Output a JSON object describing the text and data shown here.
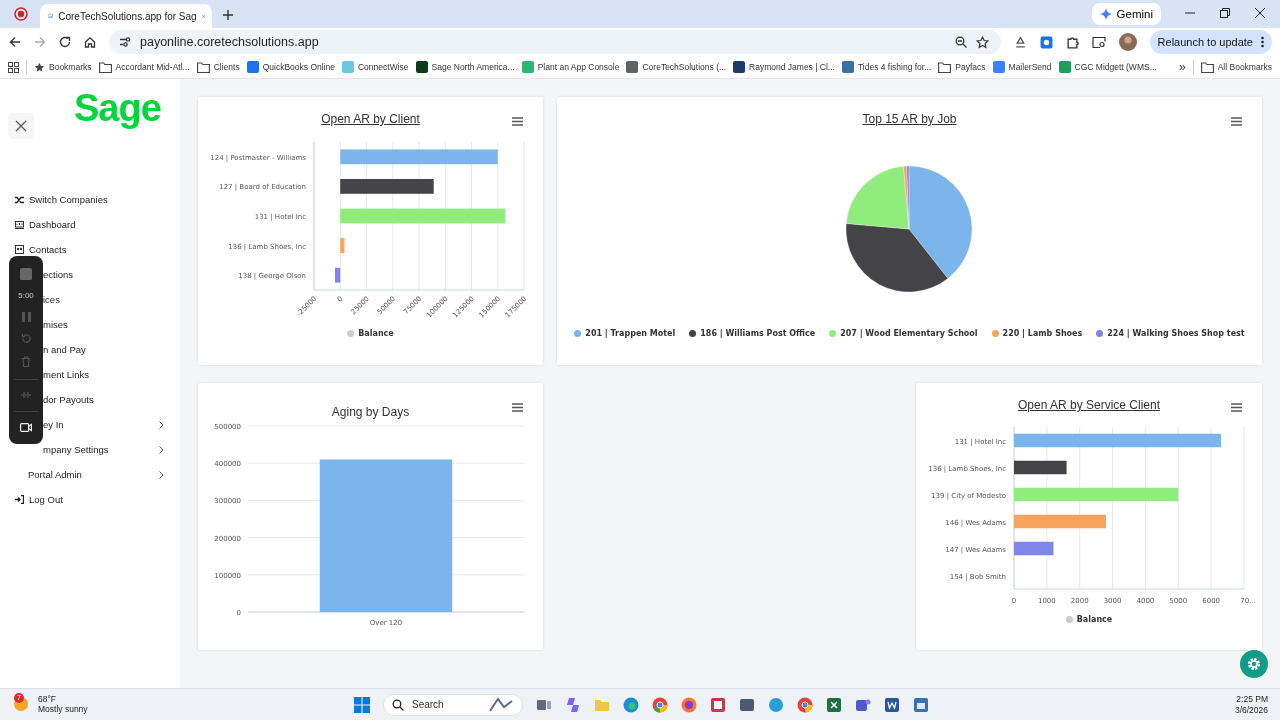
{
  "browser": {
    "tabs": [
      {
        "title": "CoreTechSolutions.app for Sag",
        "selected": true
      }
    ],
    "gemini_button": "Gemini",
    "address": "payonline.coretechsolutions.app",
    "relaunch_button": "Relaunch to update",
    "bookmarks": [
      {
        "label": "Bookmarks",
        "kind": "star"
      },
      {
        "label": "Accordant Mid-Atl...",
        "kind": "folder"
      },
      {
        "label": "Clients",
        "kind": "folder"
      },
      {
        "label": "QuickBooks Online",
        "kind": "site",
        "color": "#1a73e8"
      },
      {
        "label": "ConnectWise",
        "kind": "site",
        "color": "#6cc6e0"
      },
      {
        "label": "Sage North America...",
        "kind": "site",
        "color": "#0b3d1c"
      },
      {
        "label": "Plant an App Console",
        "kind": "site",
        "color": "#2bb673"
      },
      {
        "label": "CoreTechSolutions (...",
        "kind": "site",
        "color": "#5f6368"
      },
      {
        "label": "Raymond James | Cl...",
        "kind": "site",
        "color": "#1f3a68"
      },
      {
        "label": "Tides 4 fishing for...",
        "kind": "site",
        "color": "#3b6ea5"
      },
      {
        "label": "Payfacs",
        "kind": "folder"
      },
      {
        "label": "MailerSend",
        "kind": "site",
        "color": "#3b82f6"
      },
      {
        "label": "CGC Midgett (WMS...",
        "kind": "site",
        "color": "#1e9e5a"
      }
    ],
    "more_bookmarks": "»",
    "all_bookmarks": "All Bookmarks"
  },
  "sidebar": {
    "logo": "Sage",
    "items": [
      {
        "label": "Switch Companies",
        "kind": "shuffle",
        "covered": false,
        "submenu": false
      },
      {
        "label": "Dashboard",
        "kind": "dashboard",
        "covered": false,
        "submenu": false
      },
      {
        "label": "Contacts",
        "kind": "contacts",
        "covered": false,
        "submenu": false
      },
      {
        "label": "ections",
        "kind": "plain",
        "covered": true,
        "submenu": false
      },
      {
        "label": "ices",
        "kind": "plain",
        "covered": true,
        "submenu": false
      },
      {
        "label": "mises",
        "kind": "plain",
        "covered": true,
        "submenu": false
      },
      {
        "label": "n and Pay",
        "kind": "plain",
        "covered": true,
        "submenu": false
      },
      {
        "label": "ment Links",
        "kind": "plain",
        "covered": true,
        "submenu": false
      },
      {
        "label": "dor Payouts",
        "kind": "plain",
        "covered": true,
        "submenu": false
      },
      {
        "label": "ey In",
        "kind": "plain",
        "covered": true,
        "submenu": true
      },
      {
        "label": "mpany Settings",
        "kind": "plain",
        "covered": true,
        "submenu": true
      },
      {
        "label": "Portal Admin",
        "kind": "plain",
        "covered": false,
        "submenu": true
      },
      {
        "label": "Log Out",
        "kind": "logout",
        "covered": false,
        "submenu": false
      }
    ]
  },
  "recorder": {
    "timer": "5:00"
  },
  "charts": [
    {
      "title": "Open AR by Client",
      "link": true,
      "chart_data": {
        "type": "bar",
        "orientation": "horizontal",
        "stacked": true,
        "grid": true,
        "categories": [
          "124 | Postmaster - Williams",
          "127 | Board of Education",
          "131 | Hotel Inc",
          "136 | Lamb Shoes, Inc",
          "138 | George Olson"
        ],
        "series": [
          {
            "name": "Balance",
            "color": "#7cb5ec",
            "values": [
              150000,
              null,
              null,
              null,
              null
            ]
          },
          {
            "color": "#434348",
            "values": [
              null,
              89000,
              null,
              null,
              null
            ]
          },
          {
            "color": "#90ed7d",
            "values": [
              null,
              null,
              157000,
              null,
              null
            ]
          },
          {
            "color": "#f7a35c",
            "values": [
              null,
              null,
              null,
              4000,
              null
            ]
          },
          {
            "color": "#8085e9",
            "values": [
              null,
              null,
              null,
              null,
              -5000
            ]
          }
        ],
        "xlim": [
          -25000,
          175000
        ],
        "xticks": [
          -25000,
          0,
          25000,
          50000,
          75000,
          100000,
          125000,
          150000,
          175000
        ]
      }
    },
    {
      "title": "Top 15 AR by Job",
      "link": true,
      "slices": [
        {
          "color": "#7cb5ec"
        },
        {
          "color": "#434348"
        },
        {
          "color": "#90ed7d"
        },
        {
          "color": "#f7a35c"
        },
        {
          "color": "#8085e9"
        }
      ],
      "chart_data": {
        "type": "pie",
        "categories": [
          "201 | Trappen Motel",
          "186 | Williams Post Office",
          "207 | Wood Elementary School",
          "220 | Lamb Shoes",
          "224 | Walking Shoes Shop test"
        ],
        "series": [
          {
            "values": [
              39.4,
              37.0,
              22.2,
              0.8,
              0.6
            ]
          }
        ]
      }
    },
    {
      "title": "Aging by Days",
      "link": false,
      "chart_data": {
        "type": "bar",
        "orientation": "vertical",
        "grid": true,
        "categories": [
          "Over 120"
        ],
        "series": [
          {
            "color": "#7cb5ec",
            "values": [
              410000
            ]
          }
        ],
        "ylim": [
          0,
          500000
        ],
        "yticks": [
          0,
          100000,
          200000,
          300000,
          400000,
          500000
        ]
      }
    },
    {
      "title": "Open AR by Service Client",
      "link": true,
      "chart_data": {
        "type": "bar",
        "orientation": "horizontal",
        "stacked": true,
        "grid": true,
        "categories": [
          "131 | Hotel Inc",
          "136 | Lamb Shoes, Inc",
          "139 | City of Modesto",
          "146 | Wes Adams",
          "147 | Wes Adams",
          "154 | Bob Smith"
        ],
        "series": [
          {
            "name": "Balance",
            "color": "#7cb5ec",
            "values": [
              6300,
              null,
              null,
              null,
              null,
              null
            ]
          },
          {
            "color": "#434348",
            "values": [
              null,
              1600,
              null,
              null,
              null,
              null
            ]
          },
          {
            "color": "#90ed7d",
            "values": [
              null,
              null,
              5000,
              null,
              null,
              null
            ]
          },
          {
            "color": "#f7a35c",
            "values": [
              null,
              null,
              null,
              2800,
              null,
              null
            ]
          },
          {
            "color": "#8085e9",
            "values": [
              null,
              null,
              null,
              null,
              1200,
              null
            ]
          },
          {
            "color": "#f15c80",
            "values": [
              null,
              null,
              null,
              null,
              null,
              0
            ]
          }
        ],
        "xlim": [
          0,
          7000
        ],
        "xticks": [
          0,
          1000,
          2000,
          3000,
          4000,
          5000,
          6000,
          {
            "value": 7000,
            "label": "70..."
          }
        ]
      }
    }
  ],
  "taskbar": {
    "weather_badge": "7",
    "temperature": "68°F",
    "weather": "Mostly sunny",
    "search_placeholder": "Search",
    "time": "2:25 PM",
    "date": "3/6/2026"
  }
}
